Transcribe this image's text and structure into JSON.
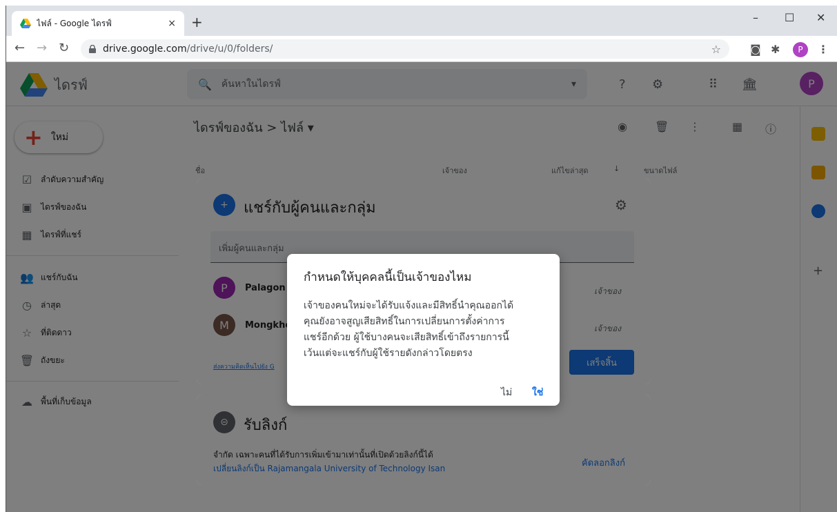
{
  "browser": {
    "tab_title": "ไฟล์ - Google ไดรฟ์",
    "tab_close": "×",
    "new_tab": "+",
    "url_host": "drive.google.com",
    "url_path": "/drive/u/0/folders/",
    "profile_initial": "P",
    "window_minimize": "–",
    "window_maximize": "☐",
    "window_close": "✕"
  },
  "drive": {
    "logo_text": "ไดรฟ์",
    "search_placeholder": "ค้นหาในไดรฟ์",
    "profile_initial": "P",
    "new_button": "ใหม่",
    "sidebar": [
      {
        "label": "ลำดับความสำคัญ",
        "icon": "☑"
      },
      {
        "label": "ไดรฟ์ของฉัน",
        "icon": "▣"
      },
      {
        "label": "ไดรฟ์ที่แชร์",
        "icon": "▦"
      },
      {
        "label": "แชร์กับฉัน",
        "icon": "👥"
      },
      {
        "label": "ล่าสุด",
        "icon": "◷"
      },
      {
        "label": "ที่ติดดาว",
        "icon": "☆"
      },
      {
        "label": "ถังขยะ",
        "icon": "🗑"
      },
      {
        "label": "พื้นที่เก็บข้อมูล",
        "icon": "☁"
      }
    ],
    "breadcrumb": "ไดรฟ์ของฉัน  >  ไฟล์ ▾",
    "columns": {
      "name": "ชื่อ",
      "owner": "เจ้าของ",
      "modified": "แก้ไขล่าสุด",
      "size": "ขนาดไฟล์"
    }
  },
  "share_dialog": {
    "title": "แชร์กับผู้คนและกลุ่ม",
    "add_placeholder": "เพิ่มผู้คนและกลุ่ม",
    "people": [
      {
        "initial": "P",
        "name": "Palagon",
        "role": "เจ้าของ",
        "color": "#9c27b0"
      },
      {
        "initial": "M",
        "name": "Mongkho",
        "role": "เจ้าของ",
        "color": "#795548"
      }
    ],
    "feedback_link": "ส่งความคิดเห็นไปยัง G",
    "done_button": "เสร็จสิ้น"
  },
  "link_card": {
    "title": "รับลิงก์",
    "description": "จำกัด เฉพาะคนที่ได้รับการเพิ่มเข้ามาเท่านั้นที่เปิดด้วยลิงก์นี้ได้",
    "change_link": "เปลี่ยนลิงก์เป็น Rajamangala University of Technology Isan",
    "copy_link": "คัดลอกลิงก์"
  },
  "confirm_dialog": {
    "title": "กำหนดให้บุคคลนี้เป็นเจ้าของไหม",
    "body_lines": [
      "เจ้าของคนใหม่จะได้รับแจ้งและมีสิทธิ์นำคุณออกได้",
      "คุณยังอาจสูญเสียสิทธิ์ในการเปลี่ยนการตั้งค่าการ",
      "แชร์อีกด้วย ผู้ใช้บางคนจะเสียสิทธิ์เข้าถึงรายการนี้",
      "เว้นแต่จะแชร์กับผู้ใช้รายดังกล่าวโดยตรง"
    ],
    "no_button": "ไม่",
    "yes_button": "ใช่"
  },
  "colors": {
    "accent": "#1a73e8",
    "profile": "#b042c4"
  }
}
